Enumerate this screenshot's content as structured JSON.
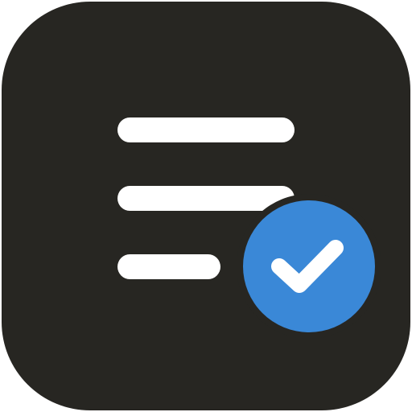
{
  "app_icon": {
    "name": "checklist-app-icon",
    "tile_color": "#272622",
    "line_color": "#ffffff",
    "badge_color": "#3a88d7",
    "check_color": "#ffffff",
    "icon_parts": [
      "list-lines-icon",
      "check-badge-icon",
      "checkmark-icon"
    ]
  }
}
